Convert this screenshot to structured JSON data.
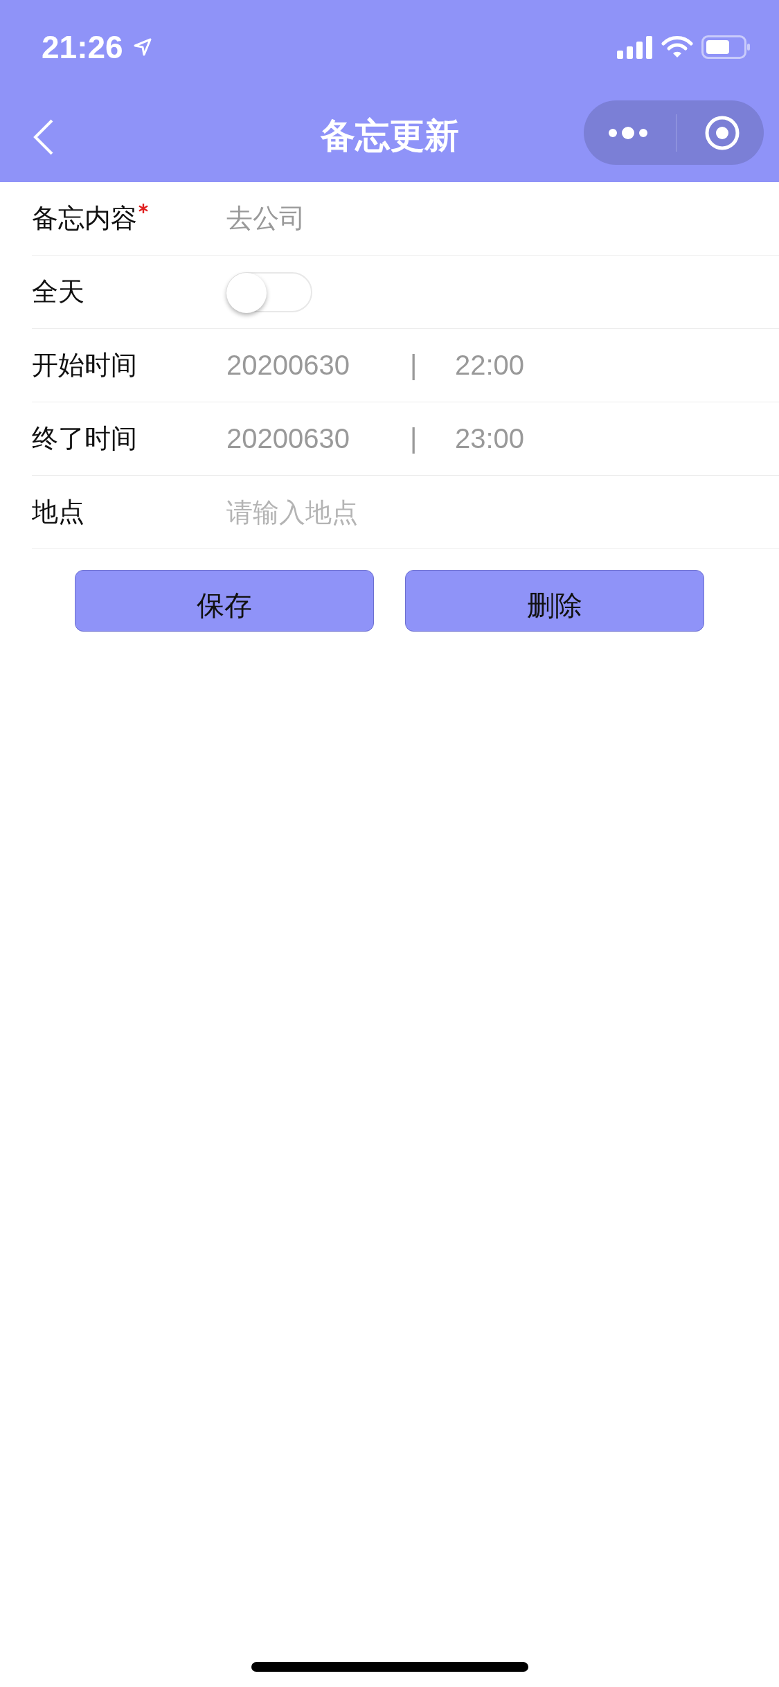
{
  "status_bar": {
    "time": "21:26"
  },
  "nav": {
    "title": "备忘更新"
  },
  "form": [
    {
      "kind": "text",
      "label": "备忘内容",
      "required": true,
      "value": "去公司"
    },
    {
      "kind": "switch",
      "label": "全天",
      "on": false
    },
    {
      "kind": "datetime",
      "label": "开始时间",
      "date": "20200630",
      "separator": "|",
      "time": "22:00"
    },
    {
      "kind": "datetime",
      "label": "终了时间",
      "date": "20200630",
      "separator": "|",
      "time": "23:00"
    },
    {
      "kind": "text",
      "label": "地点",
      "required": false,
      "placeholder": "请输入地点"
    }
  ],
  "buttons": [
    "保存",
    "删除"
  ]
}
